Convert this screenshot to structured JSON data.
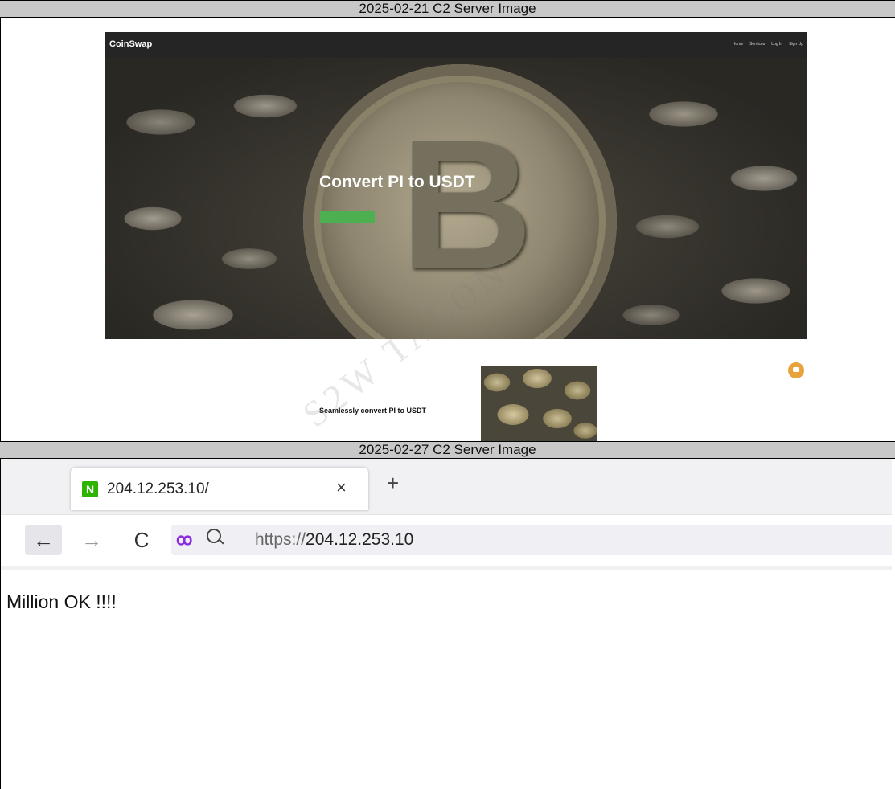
{
  "captions": {
    "first": "2025-02-21 C2 Server Image",
    "second": "2025-02-27 C2 Server Image"
  },
  "coinswap": {
    "brand": "CoinSwap",
    "nav": [
      "Home",
      "Services",
      "Log In",
      "Sign Up"
    ],
    "hero_title": "Convert PI to USDT",
    "section2_title": "Seamlessly convert PI to USDT"
  },
  "browser": {
    "favicon_letter": "N",
    "tab_title": "204.12.253.10/",
    "close_glyph": "×",
    "new_tab_glyph": "+",
    "url_scheme": "https://",
    "url_host": "204.12.253.10",
    "page_text": "Million OK !!!!"
  },
  "icons": {
    "back": "←",
    "forward": "→",
    "reload": "C",
    "permissions": "ꝏ"
  },
  "colors": {
    "caption_bg": "#c8c8c8",
    "favicon_green": "#2db400",
    "hero_button_green": "#4caf50"
  }
}
